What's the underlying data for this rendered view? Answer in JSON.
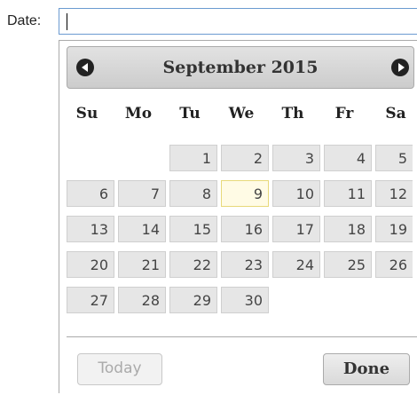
{
  "date_field": {
    "label": "Date:",
    "value": ""
  },
  "calendar": {
    "month_year": "September 2015",
    "prev_icon": "circle-triangle-left-icon",
    "next_icon": "circle-triangle-right-icon",
    "weekdays": [
      "Su",
      "Mo",
      "Tu",
      "We",
      "Th",
      "Fr",
      "Sa"
    ],
    "weeks": [
      [
        "",
        "",
        "1",
        "2",
        "3",
        "4",
        "5"
      ],
      [
        "6",
        "7",
        "8",
        "9",
        "10",
        "11",
        "12"
      ],
      [
        "13",
        "14",
        "15",
        "16",
        "17",
        "18",
        "19"
      ],
      [
        "20",
        "21",
        "22",
        "23",
        "24",
        "25",
        "26"
      ],
      [
        "27",
        "28",
        "29",
        "30",
        "",
        "",
        ""
      ]
    ],
    "highlighted_day": "9"
  },
  "buttons": {
    "today": "Today",
    "done": "Done"
  },
  "colors": {
    "input_border": "#6b9bd1",
    "header_bg": "#d6d6d6",
    "day_bg": "#e6e6e6",
    "highlight_bg": "#fffbe5",
    "highlight_border": "#e8d97a"
  }
}
